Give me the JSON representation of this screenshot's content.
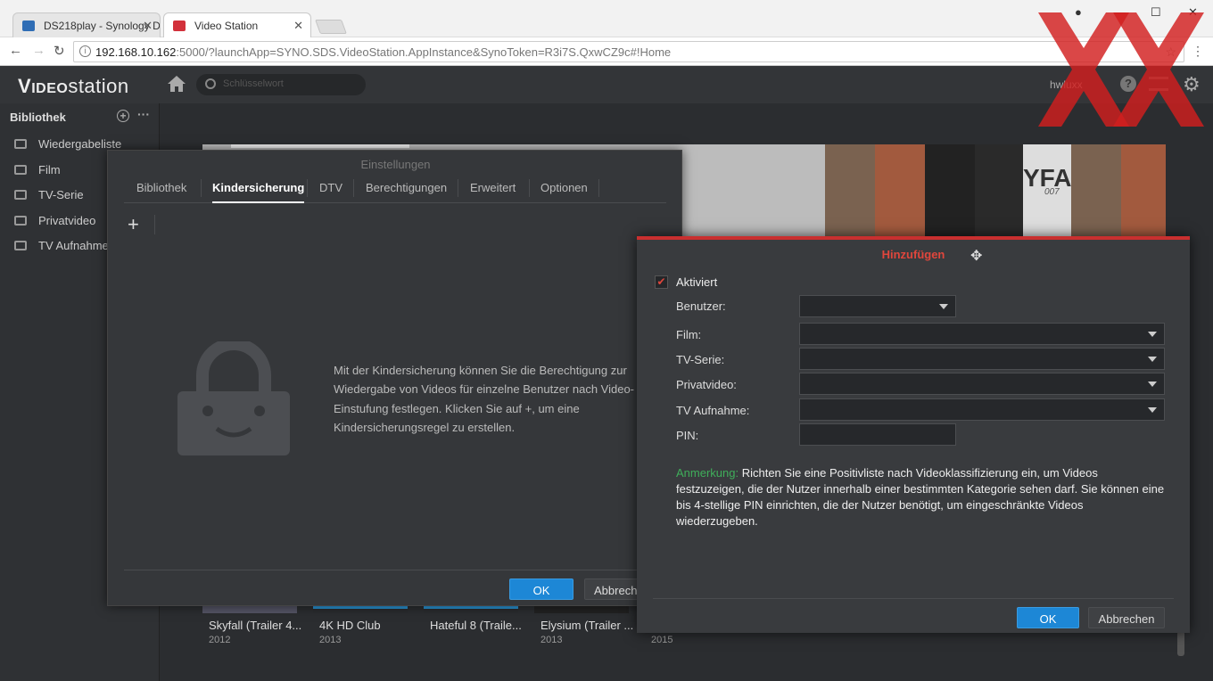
{
  "browser": {
    "tabs": [
      {
        "label": "DS218play - Synology Di",
        "favicon_color": "#2f6db5"
      },
      {
        "label": "Video Station",
        "favicon_color": "#d2313b"
      }
    ],
    "address": {
      "host": "192.168.10.162",
      "rest": ":5000/?launchApp=SYNO.SDS.VideoStation.AppInstance&SynoToken=R3i7S.QxwCZ9c#!Home"
    }
  },
  "app": {
    "logo_bold": "V",
    "logo_mid": "IDEO",
    "logo_rest": "station",
    "search_placeholder": "Schlüsselwort",
    "user": "hwluxx"
  },
  "sidebar": {
    "title": "Bibliothek",
    "items": [
      {
        "label": "Wiedergabeliste",
        "icon": "playlist-icon"
      },
      {
        "label": "Film",
        "icon": "film-icon"
      },
      {
        "label": "TV-Serie",
        "icon": "tv-icon"
      },
      {
        "label": "Privatvideo",
        "icon": "camera-icon"
      },
      {
        "label": "TV Aufnahme",
        "icon": "recording-icon"
      }
    ]
  },
  "thumbnails": [
    {
      "title": "Skyfall (Trailer 4...",
      "year": "2012"
    },
    {
      "title": "4K HD Club",
      "year": "2013"
    },
    {
      "title": "Hateful 8 (Traile...",
      "year": ""
    },
    {
      "title": "Elysium (Trailer ...",
      "year": "2013"
    },
    {
      "title": "",
      "year": "2015"
    }
  ],
  "banner_text": {
    "title": "YFA",
    "sub": "007"
  },
  "settings": {
    "title": "Einstellungen",
    "tabs": [
      "Bibliothek",
      "Kindersicherung",
      "DTV",
      "Berechtigungen",
      "Erweitert",
      "Optionen"
    ],
    "active_tab": "Kindersicherung",
    "add_label": "+",
    "message": "Mit der Kindersicherung können Sie die Berechtigung zur Wiedergabe von Videos für einzelne Benutzer nach Video-Einstufung festlegen. Klicken Sie auf +, um eine Kindersicherungsregel zu erstellen.",
    "ok": "OK",
    "cancel": "Abbrechen"
  },
  "add_dialog": {
    "title": "Hinzufügen",
    "enabled_label": "Aktiviert",
    "enabled": true,
    "fields": {
      "user": "Benutzer:",
      "film": "Film:",
      "tvseries": "TV-Serie:",
      "private": "Privatvideo:",
      "recording": "TV Aufnahme:",
      "pin": "PIN:"
    },
    "note_label": "Anmerkung:",
    "note_text": " Richten Sie eine Positivliste nach Videoklassifizierung ein, um Videos festzuzeigen, die der Nutzer innerhalb einer bestimmten Kategorie sehen darf. Sie können eine bis 4-stellige PIN einrichten, die der Nutzer benötigt, um eingeschränkte Videos wiederzugeben.",
    "ok": "OK",
    "cancel": "Abbrechen"
  },
  "colors": {
    "accent": "#1d87d6",
    "dialog_accent": "#c92f2f",
    "note_label": "#3fae5a"
  }
}
